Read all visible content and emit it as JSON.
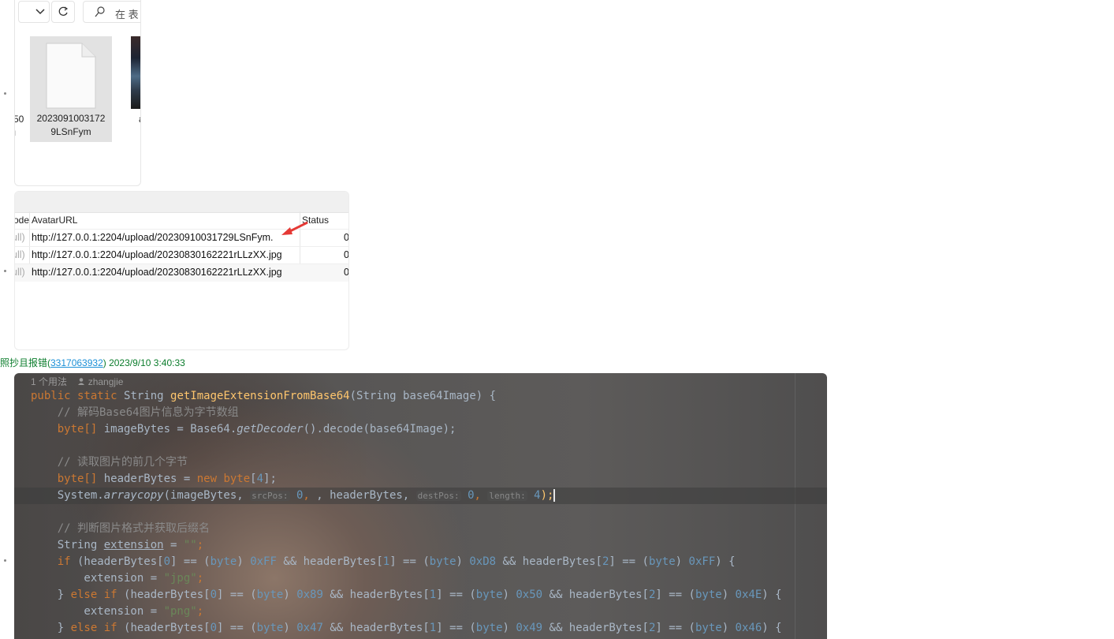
{
  "explorer": {
    "search_placeholder": "在 表",
    "file_name_line1": "2023091003172",
    "file_name_line2": "9LSnFym",
    "edge_text_1": "50",
    "edge_text_2": "ı",
    "edge_text_3": "a"
  },
  "table": {
    "headers": {
      "code": "ode",
      "avatar": "AvatarURL",
      "status": "Status"
    },
    "rows": [
      {
        "code": "ull)",
        "url": "http://127.0.0.1:2204/upload/20230910031729LSnFym.",
        "status": "0"
      },
      {
        "code": "ull)",
        "url": "http://127.0.0.1:2204/upload/20230830162221rLLzXX.jpg",
        "status": "0"
      },
      {
        "code": "ull)",
        "url": "http://127.0.0.1:2204/upload/20230830162221rLLzXX.jpg",
        "status": "0"
      }
    ]
  },
  "chat": {
    "prefix": "照抄且报错(",
    "user_id": "3317063932",
    "suffix": ") 2023/9/10 3:40:33"
  },
  "code": {
    "usage": "1 个用法",
    "author": "zhangjie",
    "lines": {
      "l1": {
        "kw": "public static ",
        "type": "String ",
        "fn": "getImageExtensionFromBase64",
        "rest": "(String base64Image) {"
      },
      "l2": "    // 解码Base64图片信息为字节数组",
      "l3a": "    byte[] ",
      "l3b": "imageBytes = Base64.",
      "l3c": "getDecoder",
      "l3d": "().decode(base64Image);",
      "l5": "    // 读取图片的前几个字节",
      "l6a": "    byte[] ",
      "l6b": "headerBytes = ",
      "l6c": "new byte",
      "l6d": "[",
      "l6e": "4",
      "l6f": "];",
      "l7a": "    System.",
      "l7b": "arraycopy",
      "l7c": "(imageBytes, ",
      "l7h1": "srcPos:",
      "l7d": " 0",
      "l7e": ", headerBytes, ",
      "l7h2": "destPos:",
      "l7f": " 0",
      "l7g": ", ",
      "l7h3": "length:",
      "l7i": " 4",
      "l7j": ");",
      "l9": "    // 判断图片格式并获取后缀名",
      "l10a": "    String ",
      "l10b": "extension",
      "l10c": " = ",
      "l10d": "\"\"",
      "l10e": ";",
      "l11": [
        "    ",
        "if",
        " (headerBytes[",
        "0",
        "] == (",
        "byte",
        ") ",
        "0xFF",
        " && headerBytes[",
        "1",
        "] == (",
        "byte",
        ") ",
        "0xD8",
        " && headerBytes[",
        "2",
        "] == (",
        "byte",
        ") ",
        "0xFF",
        ") {"
      ],
      "l12a": "        extension = ",
      "l12b": "\"jpg\"",
      "l12c": ";",
      "l13": [
        "    } ",
        "else if",
        " (headerBytes[",
        "0",
        "] == (",
        "byte",
        ") ",
        "0x89",
        " && headerBytes[",
        "1",
        "] == (",
        "byte",
        ") ",
        "0x50",
        " && headerBytes[",
        "2",
        "] == (",
        "byte",
        ") ",
        "0x4E",
        ") {"
      ],
      "l14a": "        extension = ",
      "l14b": "\"png\"",
      "l14c": ";",
      "l15": [
        "    } ",
        "else if",
        " (headerBytes[",
        "0",
        "] == (",
        "byte",
        ") ",
        "0x47",
        " && headerBytes[",
        "1",
        "] == (",
        "byte",
        ") ",
        "0x49",
        " && headerBytes[",
        "2",
        "] == (",
        "byte",
        ") ",
        "0x46",
        ") {"
      ]
    }
  },
  "colors": {
    "chat_green": "#0a7c2b",
    "link_blue": "#1a8fd6",
    "arrow_red": "#e53935"
  }
}
